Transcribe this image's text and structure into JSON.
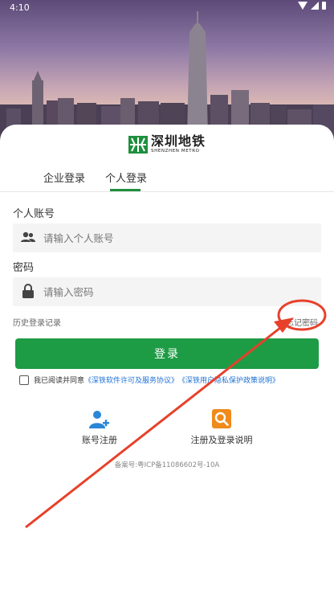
{
  "status_bar": {
    "time": "4:10"
  },
  "logo": {
    "cn": "深圳地铁",
    "en": "SHENZHEN METRO"
  },
  "tabs": [
    {
      "label": "企业登录",
      "active": false
    },
    {
      "label": "个人登录",
      "active": true
    }
  ],
  "account": {
    "label": "个人账号",
    "placeholder": "请输入个人账号",
    "value": ""
  },
  "password": {
    "label": "密码",
    "placeholder": "请输入密码",
    "value": ""
  },
  "links": {
    "history": "历史登录记录",
    "forgot": "忘记密码"
  },
  "login_button": "登录",
  "agreement": {
    "prefix": "我已阅读并同意",
    "license": "《深铁软件许可及服务协议》",
    "privacy": "《深铁用户隐私保护政策说明》",
    "checked": false
  },
  "shortcuts": [
    {
      "label": "账号注册",
      "icon": "add-user-icon"
    },
    {
      "label": "注册及登录说明",
      "icon": "search-doc-icon"
    }
  ],
  "icp": "备案号:粤ICP备11086602号-10A",
  "colors": {
    "brand_green": "#1e9b45",
    "link_blue": "#1f72d6",
    "annotation_red": "#e8402a"
  }
}
